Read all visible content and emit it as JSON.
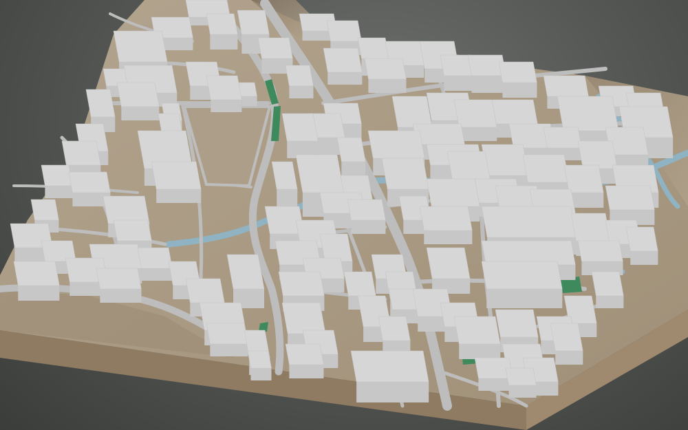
{
  "scene": {
    "kind": "3d-city-terrain-model",
    "view": "oblique-perspective",
    "colors": {
      "background_center": "#6f726f",
      "background_edge": "#3b3d3b",
      "terrain": "#a99a86",
      "terrain_shadow": "#93846f",
      "slab_side_front": "#8f7b62",
      "slab_side_right": "#a08a6f",
      "building_roof": "#d6d6d6",
      "building_side": "#b8b8b8",
      "building_front": "#c7c7c7",
      "road": "#bdbdbd",
      "river": "#8fb3c2",
      "park": "#3f8a5c"
    },
    "legend": "none",
    "labels": "none"
  }
}
